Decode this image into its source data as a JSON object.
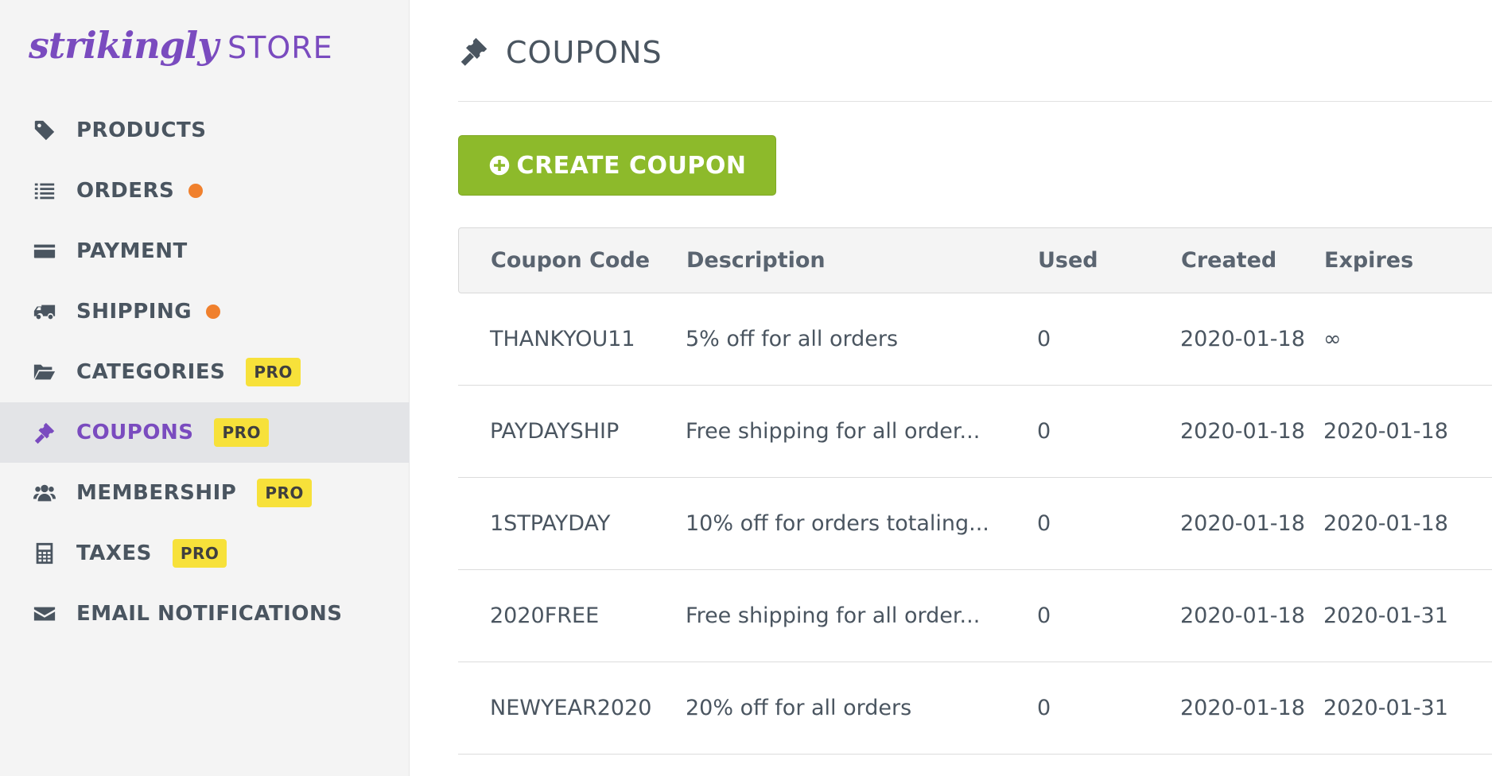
{
  "brand": {
    "script": "strikingly",
    "store": "STORE"
  },
  "sidebar": {
    "items": [
      {
        "label": "PRODUCTS",
        "icon": "tag-icon"
      },
      {
        "label": "ORDERS",
        "icon": "list-icon",
        "dot": true
      },
      {
        "label": "PAYMENT",
        "icon": "credit-card-icon"
      },
      {
        "label": "SHIPPING",
        "icon": "truck-icon",
        "dot": true
      },
      {
        "label": "CATEGORIES",
        "icon": "folder-open-icon",
        "badge": "PRO"
      },
      {
        "label": "COUPONS",
        "icon": "ticket-icon",
        "badge": "PRO",
        "active": true
      },
      {
        "label": "MEMBERSHIP",
        "icon": "users-icon",
        "badge": "PRO"
      },
      {
        "label": "TAXES",
        "icon": "calculator-icon",
        "badge": "PRO"
      },
      {
        "label": "EMAIL NOTIFICATIONS",
        "icon": "envelope-icon"
      }
    ]
  },
  "main": {
    "title": "COUPONS",
    "create_button": "CREATE COUPON",
    "table": {
      "headers": [
        "Coupon Code",
        "Description",
        "Used",
        "Created",
        "Expires"
      ],
      "rows": [
        [
          "THANKYOU11",
          "5% off for all orders",
          "0",
          "2020-01-18",
          "∞"
        ],
        [
          "PAYDAYSHIP",
          "Free shipping for all order...",
          "0",
          "2020-01-18",
          "2020-01-18"
        ],
        [
          "1STPAYDAY",
          "10% off for orders totaling...",
          "0",
          "2020-01-18",
          "2020-01-18"
        ],
        [
          "2020FREE",
          "Free shipping for all order...",
          "0",
          "2020-01-18",
          "2020-01-31"
        ],
        [
          "NEWYEAR2020",
          "20% off for all orders",
          "0",
          "2020-01-18",
          "2020-01-31"
        ]
      ]
    }
  },
  "colors": {
    "accent": "#7a4bbf",
    "button": "#8dba2b",
    "dot": "#f0802d",
    "pro_badge": "#f7e13a"
  }
}
